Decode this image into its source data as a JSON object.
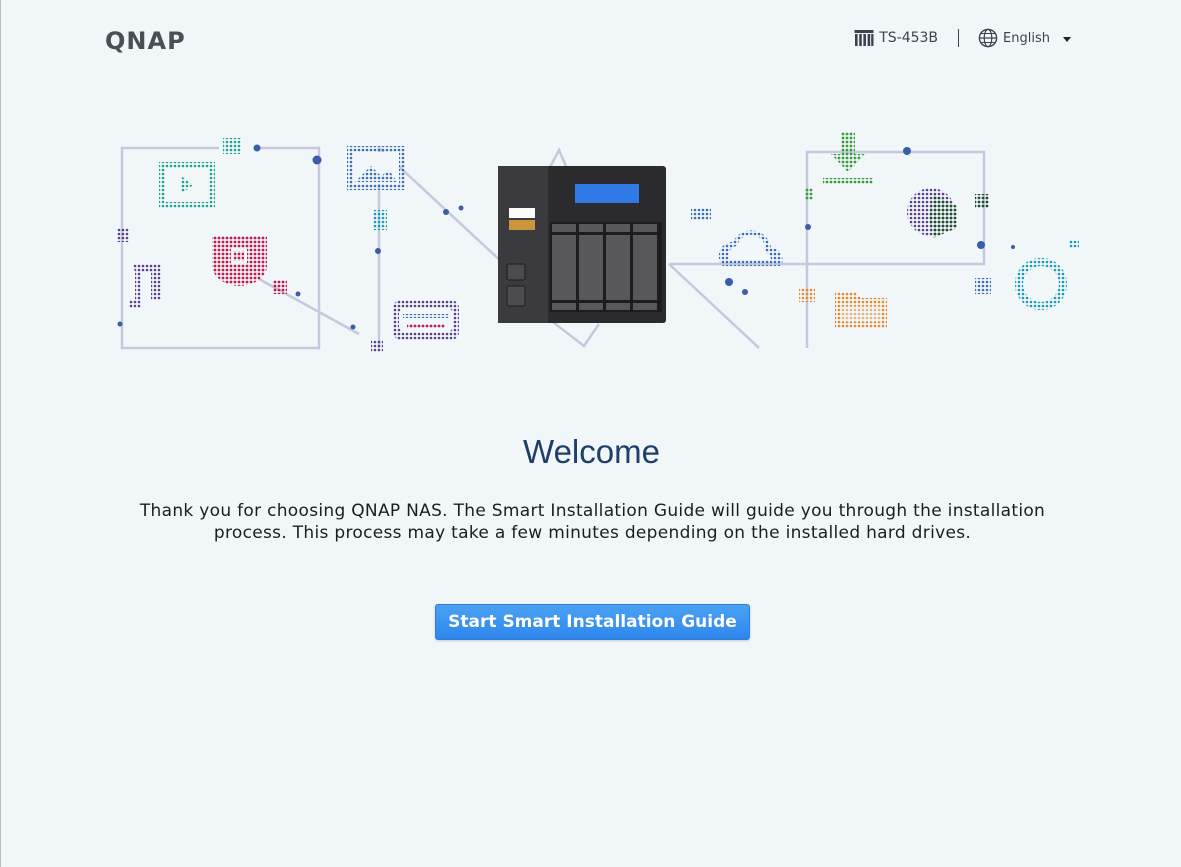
{
  "header": {
    "brand": "QNAP",
    "model": "TS-453B",
    "language": "English"
  },
  "main": {
    "title": "Welcome",
    "description": "Thank you for choosing QNAP NAS. The Smart Installation Guide will guide you through the installation process. This process may take a few minutes depending on the installed hard drives.",
    "start_button_label": "Start Smart Installation Guide"
  },
  "colors": {
    "background": "#f1f6f9",
    "title": "#1e3f6a",
    "button": "#3a94f0",
    "illustration_lines": "#c5c8de"
  }
}
